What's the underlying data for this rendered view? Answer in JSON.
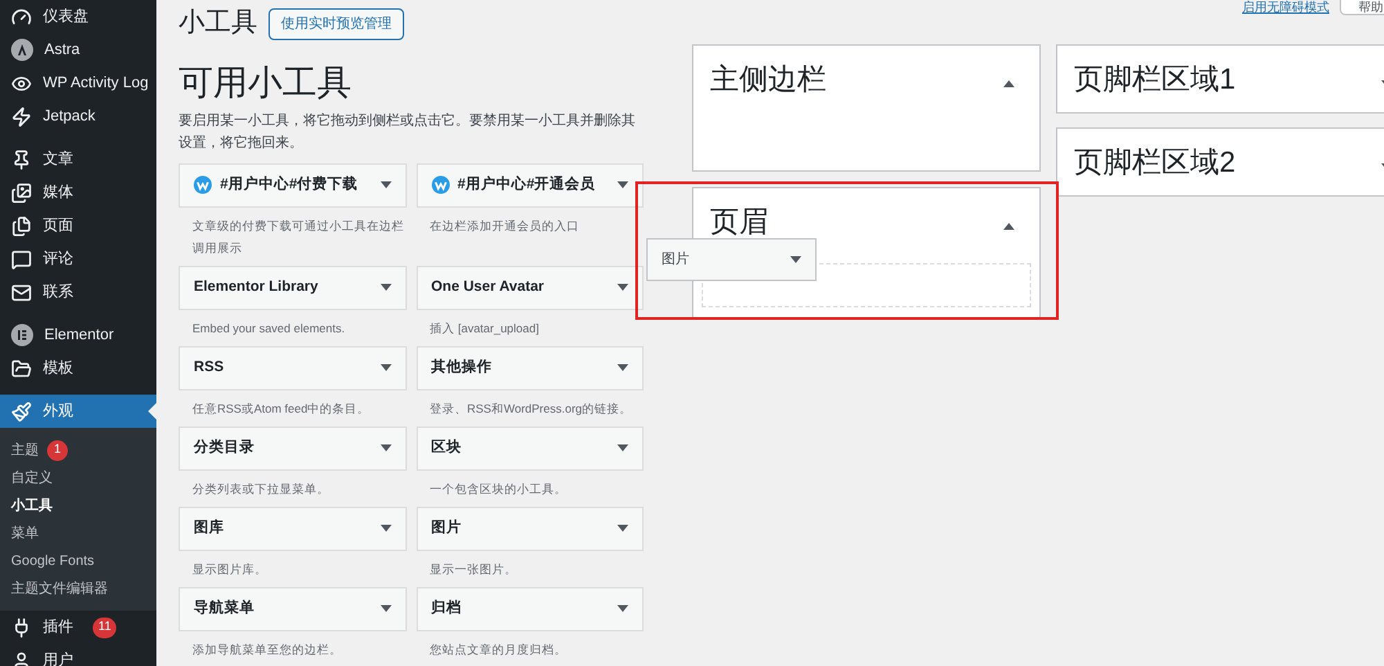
{
  "admin_menu": [
    {
      "label": "仪表盘",
      "selected": false
    },
    {
      "label": "Astra",
      "selected": false
    },
    {
      "label": "WP Activity Log",
      "selected": false
    },
    {
      "label": "Jetpack",
      "selected": false
    },
    {
      "label": "文章",
      "selected": false
    },
    {
      "label": "媒体",
      "selected": false
    },
    {
      "label": "页面",
      "selected": false
    },
    {
      "label": "评论",
      "selected": false
    },
    {
      "label": "联系",
      "selected": false
    },
    {
      "label": "Elementor",
      "selected": false
    },
    {
      "label": "模板",
      "selected": false
    },
    {
      "label": "外观",
      "selected": true,
      "children": [
        {
          "label": "主题",
          "badge": "1",
          "selected": false
        },
        {
          "label": "自定义",
          "selected": false
        },
        {
          "label": "小工具",
          "selected": true
        },
        {
          "label": "菜单",
          "selected": false
        },
        {
          "label": "Google Fonts",
          "selected": false
        },
        {
          "label": "主题文件编辑器",
          "selected": false
        }
      ]
    },
    {
      "label": "插件",
      "badge": "11",
      "selected": false
    },
    {
      "label": "用户",
      "selected": false
    }
  ],
  "top_links": {
    "accessibility_link": "启用无障碍模式",
    "help_button": "帮助"
  },
  "page_title": "小工具",
  "preview_button": "使用实时预览管理",
  "available": {
    "title": "可用小工具",
    "description": "要启用某一小工具，将它拖动到侧栏或点击它。要禁用某一小工具并删除其设置，将它拖回来。",
    "widgets": [
      {
        "title": "#用户中心#付费下载",
        "description": "文章级的付费下载可通过小工具在边栏调用展示",
        "kind": "logo"
      },
      {
        "title": "#用户中心#开通会员",
        "description": "在边栏添加开通会员的入口",
        "kind": "logo"
      },
      {
        "title": "Elementor Library",
        "description": "Embed your saved elements.",
        "kind": "plain"
      },
      {
        "title": "One User Avatar",
        "description": "插入 [avatar_upload]",
        "kind": "plain"
      },
      {
        "title": "RSS",
        "description": "任意RSS或Atom feed中的条目。",
        "kind": "plain"
      },
      {
        "title": "其他操作",
        "description": "登录、RSS和WordPress.org的链接。",
        "kind": "plain"
      },
      {
        "title": "分类目录",
        "description": "分类列表或下拉显菜单。",
        "kind": "plain"
      },
      {
        "title": "区块",
        "description": "一个包含区块的小工具。",
        "kind": "plain"
      },
      {
        "title": "图库",
        "description": "显示图片库。",
        "kind": "plain"
      },
      {
        "title": "图片",
        "description": "显示一张图片。",
        "kind": "plain"
      },
      {
        "title": "导航菜单",
        "description": "添加导航菜单至您的边栏。",
        "kind": "plain"
      },
      {
        "title": "归档",
        "description": "您站点文章的月度归档。",
        "kind": "plain"
      }
    ]
  },
  "widget_areas": {
    "left": [
      {
        "title": "主侧边栏",
        "expanded": true
      },
      {
        "title": "页眉",
        "expanded": true
      }
    ],
    "right": [
      {
        "title": "页脚栏区域1",
        "expanded": false
      },
      {
        "title": "页脚栏区域2",
        "expanded": false
      }
    ]
  },
  "dragged_widget": {
    "title": "图片"
  }
}
